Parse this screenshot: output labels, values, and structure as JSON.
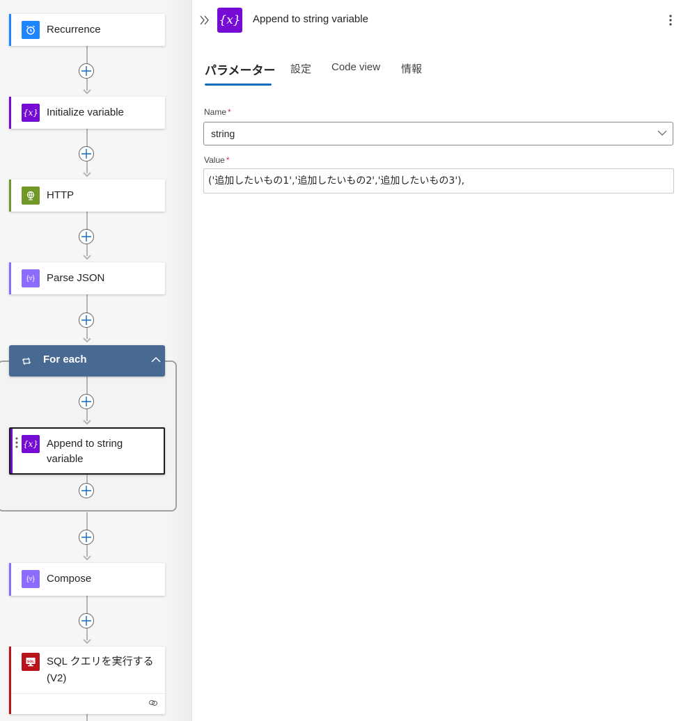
{
  "flow": {
    "steps": [
      {
        "id": "recurrence",
        "label": "Recurrence",
        "icon": "alarm-clock-icon",
        "accent": "#1f85ff",
        "icon_bg": "#1f85ff"
      },
      {
        "id": "init-variable",
        "label": "Initialize variable",
        "icon": "variable-icon",
        "accent": "#770bd6",
        "icon_bg": "#770bd6"
      },
      {
        "id": "http",
        "label": "HTTP",
        "icon": "globe-icon",
        "accent": "#709727",
        "icon_bg": "#709727"
      },
      {
        "id": "parse-json",
        "label": "Parse JSON",
        "icon": "data-operation-icon",
        "accent": "#8c6cff",
        "icon_bg": "#8c6cff"
      },
      {
        "id": "compose",
        "label": "Compose",
        "icon": "data-operation-icon",
        "accent": "#8c6cff",
        "icon_bg": "#8c6cff"
      },
      {
        "id": "sql",
        "label_line1": "SQL クエリを実行する",
        "label_line2": "(V2)",
        "icon": "sql-server-icon",
        "accent": "#ba141a",
        "icon_bg": "#ba141a"
      }
    ],
    "foreach": {
      "label": "For each",
      "color": "#486991"
    },
    "inner_step": {
      "label_line1": "Append to string",
      "label_line2": "variable",
      "icon": "variable-icon",
      "accent": "#770bd6"
    }
  },
  "panel": {
    "title": "Append to string variable",
    "tabs": [
      "パラメーター",
      "設定",
      "Code view",
      "情報"
    ],
    "active_tab": "パラメーター",
    "accent": "#0f6cbd",
    "fields": {
      "name": {
        "label": "Name",
        "required_mark": "*",
        "value": "string"
      },
      "value": {
        "label": "Value",
        "required_mark": "*",
        "value": "('追加したいもの1','追加したいもの2','追加したいもの3'),"
      }
    }
  }
}
